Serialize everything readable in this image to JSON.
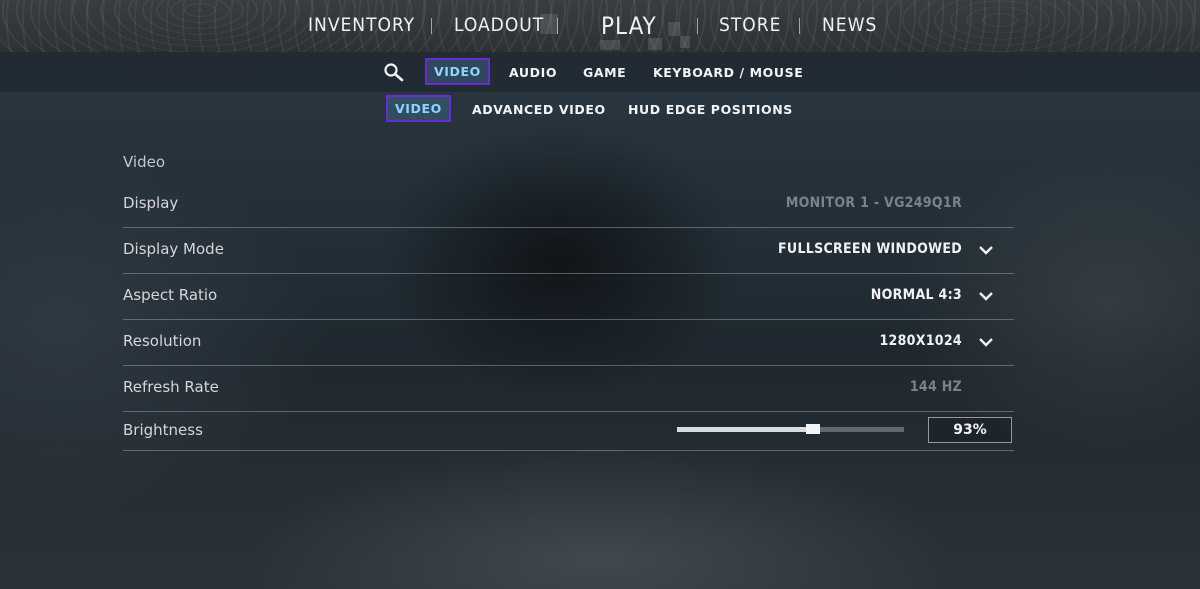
{
  "top_nav": {
    "items": [
      "INVENTORY",
      "LOADOUT",
      "PLAY",
      "STORE",
      "NEWS"
    ]
  },
  "settings_tabs": {
    "search_icon": "search-icon",
    "items": [
      "VIDEO",
      "AUDIO",
      "GAME",
      "KEYBOARD / MOUSE"
    ],
    "active": "VIDEO"
  },
  "video_subtabs": {
    "items": [
      "VIDEO",
      "ADVANCED VIDEO",
      "HUD EDGE POSITIONS"
    ],
    "active": "VIDEO"
  },
  "section": {
    "title": "Video",
    "rows": [
      {
        "label": "Display",
        "value": "MONITOR 1 - VG249Q1R",
        "dropdown": false,
        "disabled": true
      },
      {
        "label": "Display Mode",
        "value": "FULLSCREEN WINDOWED",
        "dropdown": true,
        "disabled": false
      },
      {
        "label": "Aspect Ratio",
        "value": "NORMAL 4:3",
        "dropdown": true,
        "disabled": false
      },
      {
        "label": "Resolution",
        "value": "1280X1024",
        "dropdown": true,
        "disabled": false
      },
      {
        "label": "Refresh Rate",
        "value": "144 HZ",
        "dropdown": false,
        "disabled": true
      }
    ],
    "brightness": {
      "label": "Brightness",
      "value": "93%",
      "fraction": 0.6
    }
  },
  "colors": {
    "active_tab_border": "#6a2bd6",
    "active_tab_text": "#8fd4ff"
  }
}
